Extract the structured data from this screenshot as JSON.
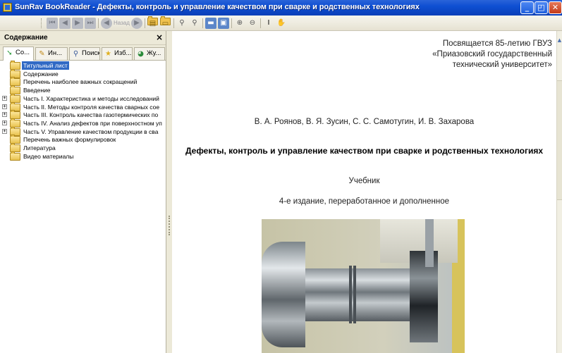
{
  "window": {
    "title": "SunRav BookReader - Дефекты, контроль и управление качеством при сварке и родственных технологиях",
    "min_glyph": "_",
    "max_glyph": "◰",
    "close_glyph": "✕"
  },
  "toolbar": {
    "back_label": "Назад",
    "icons": [
      "first-page",
      "previous-page",
      "next-page",
      "last-page",
      "back",
      "forward",
      "open-folder",
      "search",
      "find-next",
      "print",
      "layout",
      "zoom-in",
      "zoom-out",
      "text-cursor",
      "hand-tool"
    ]
  },
  "panel": {
    "title": "Содержание",
    "close_glyph": "×",
    "tabs": [
      {
        "label": "Со...",
        "icon": "contents-icon"
      },
      {
        "label": "Ин...",
        "icon": "index-icon"
      },
      {
        "label": "Поиск",
        "icon": "search-icon"
      },
      {
        "label": "Изб...",
        "icon": "favorites-icon"
      },
      {
        "label": "Жу...",
        "icon": "journal-icon"
      }
    ],
    "tree": [
      {
        "label": "Титульный лист",
        "expandable": false,
        "selected": true
      },
      {
        "label": "Содержание",
        "expandable": false
      },
      {
        "label": "Перечень наиболее важных сокращений",
        "expandable": false
      },
      {
        "label": "Введение",
        "expandable": false
      },
      {
        "label": "Часть I. Характеристика и методы исследований",
        "expandable": true
      },
      {
        "label": "Часть II. Методы контроля качества сварных сое",
        "expandable": true
      },
      {
        "label": "Часть III. Контроль качества газотермических по",
        "expandable": true
      },
      {
        "label": "Часть IV. Анализ дефектов при поверхностном уп",
        "expandable": true
      },
      {
        "label": "Часть V. Управление качеством продукции в сва",
        "expandable": true
      },
      {
        "label": "Перечень важных формулировок",
        "expandable": false
      },
      {
        "label": "Литература",
        "expandable": false
      },
      {
        "label": "Видео материалы",
        "expandable": false
      }
    ],
    "expand_glyph": "+"
  },
  "document": {
    "dedication_line1": "Посвящается 85-летию ГВУЗ",
    "dedication_line2": "«Приазовский государственный",
    "dedication_line3": "технический университет»",
    "authors": "В. А. Роянов, В. Я. Зусин, С. С. Самотугин, И. В. Захарова",
    "book_title": "Дефекты, контроль и управление качеством при сварке и родственных технологиях",
    "book_type": "Учебник",
    "edition": "4-е издание, переработанное и дополненное"
  },
  "scrollbar": {
    "up_glyph": "▲"
  }
}
